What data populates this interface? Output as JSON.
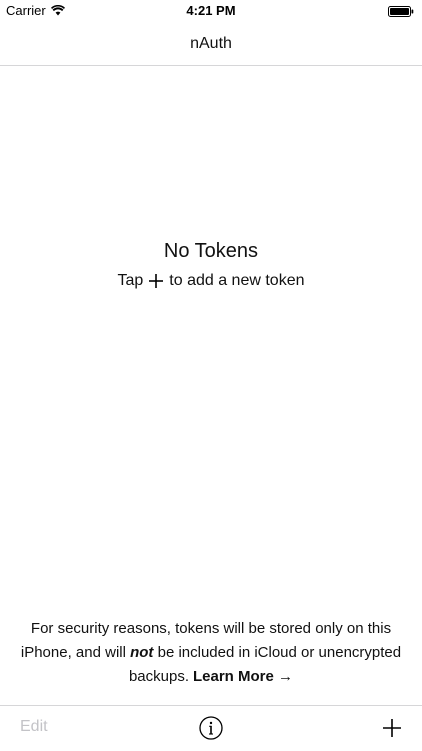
{
  "status_bar": {
    "carrier": "Carrier",
    "time": "4:21 PM",
    "icons": [
      "wifi-icon",
      "battery-icon"
    ]
  },
  "nav": {
    "title": "nAuth"
  },
  "empty_state": {
    "title": "No Tokens",
    "hint_prefix": "Tap",
    "hint_icon": "plus-icon",
    "hint_suffix": "to add a new token"
  },
  "security_note": {
    "text_part1": "For security reasons, tokens will be stored only on this iPhone, and will ",
    "emphasis": "not",
    "text_part2": " be included in iCloud or unencrypted backups.",
    "learn_more": "Learn More →"
  },
  "toolbar": {
    "edit_label": "Edit",
    "info_icon": "info-icon",
    "add_icon": "plus-icon"
  }
}
